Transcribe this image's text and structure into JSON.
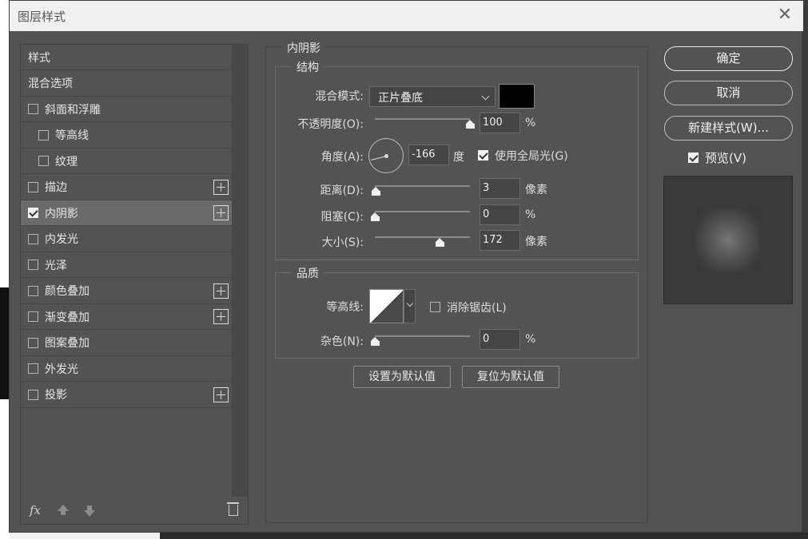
{
  "dialog": {
    "title": "图层样式",
    "close_glyph": "✕"
  },
  "left_panel": {
    "items": [
      {
        "label": "样式",
        "checkbox": false,
        "checked": false,
        "plus": false,
        "indent": false,
        "selected": false
      },
      {
        "label": "混合选项",
        "checkbox": false,
        "checked": false,
        "plus": false,
        "indent": false,
        "selected": false
      },
      {
        "label": "斜面和浮雕",
        "checkbox": true,
        "checked": false,
        "plus": false,
        "indent": false,
        "selected": false
      },
      {
        "label": "等高线",
        "checkbox": true,
        "checked": false,
        "plus": false,
        "indent": true,
        "selected": false
      },
      {
        "label": "纹理",
        "checkbox": true,
        "checked": false,
        "plus": false,
        "indent": true,
        "selected": false
      },
      {
        "label": "描边",
        "checkbox": true,
        "checked": false,
        "plus": true,
        "indent": false,
        "selected": false
      },
      {
        "label": "内阴影",
        "checkbox": true,
        "checked": true,
        "plus": true,
        "indent": false,
        "selected": true
      },
      {
        "label": "内发光",
        "checkbox": true,
        "checked": false,
        "plus": false,
        "indent": false,
        "selected": false
      },
      {
        "label": "光泽",
        "checkbox": true,
        "checked": false,
        "plus": false,
        "indent": false,
        "selected": false
      },
      {
        "label": "颜色叠加",
        "checkbox": true,
        "checked": false,
        "plus": true,
        "indent": false,
        "selected": false
      },
      {
        "label": "渐变叠加",
        "checkbox": true,
        "checked": false,
        "plus": true,
        "indent": false,
        "selected": false
      },
      {
        "label": "图案叠加",
        "checkbox": true,
        "checked": false,
        "plus": false,
        "indent": false,
        "selected": false
      },
      {
        "label": "外发光",
        "checkbox": true,
        "checked": false,
        "plus": false,
        "indent": false,
        "selected": false
      },
      {
        "label": "投影",
        "checkbox": true,
        "checked": false,
        "plus": true,
        "indent": false,
        "selected": false
      }
    ],
    "footer": {
      "fx_label": "fx",
      "icons": [
        "fx-menu-icon",
        "move-up-icon",
        "move-down-icon",
        "trash-icon"
      ]
    }
  },
  "inner_shadow": {
    "section_title": "内阴影",
    "structure": {
      "title": "结构",
      "blend_mode_label": "混合模式:",
      "blend_mode_value": "正片叠底",
      "shadow_color": "#000000",
      "opacity_label": "不透明度(O):",
      "opacity_value": "100",
      "opacity_unit": "%",
      "opacity_level": 100,
      "angle_label": "角度(A):",
      "angle_value": "-166",
      "angle_unit": "度",
      "angle_degrees": -166,
      "use_global_light_label": "使用全局光(G)",
      "use_global_light_checked": true,
      "distance_label": "距离(D):",
      "distance_value": "3",
      "distance_unit": "像素",
      "distance_level": 3,
      "choke_label": "阻塞(C):",
      "choke_value": "0",
      "choke_unit": "%",
      "choke_level": 0,
      "size_label": "大小(S):",
      "size_value": "172",
      "size_unit": "像素",
      "size_level": 172
    },
    "quality": {
      "title": "品质",
      "contour_label": "等高线:",
      "anti_alias_label": "消除锯齿(L)",
      "anti_alias_checked": false,
      "noise_label": "杂色(N):",
      "noise_value": "0",
      "noise_unit": "%",
      "noise_level": 0
    },
    "set_default_label": "设置为默认值",
    "reset_default_label": "复位为默认值"
  },
  "right_column": {
    "ok_label": "确定",
    "cancel_label": "取消",
    "new_style_label": "新建样式(W)...",
    "preview_label": "预览(V)",
    "preview_checked": true
  }
}
